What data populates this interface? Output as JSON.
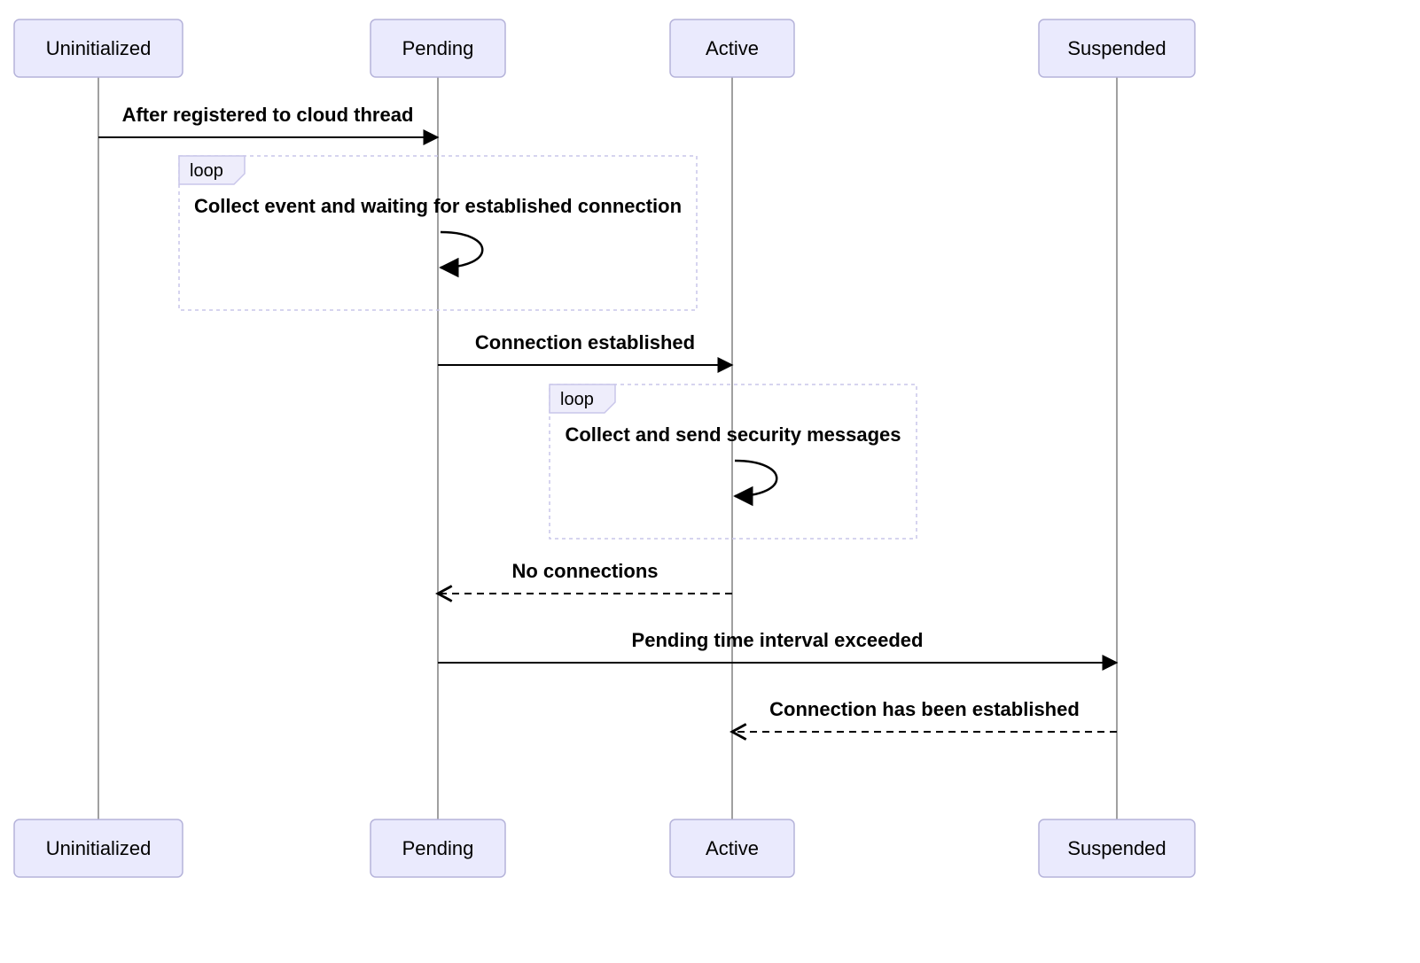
{
  "participants": {
    "p0": "Uninitialized",
    "p1": "Pending",
    "p2": "Active",
    "p3": "Suspended"
  },
  "loops": {
    "l0": {
      "tag": "loop",
      "desc": "Collect event and waiting for established connection"
    },
    "l1": {
      "tag": "loop",
      "desc": "Collect and send security messages"
    }
  },
  "messages": {
    "m0": "After registered to cloud thread",
    "m1": "Connection established",
    "m2": "No connections",
    "m3": "Pending time interval exceeded",
    "m4": "Connection has been established"
  }
}
